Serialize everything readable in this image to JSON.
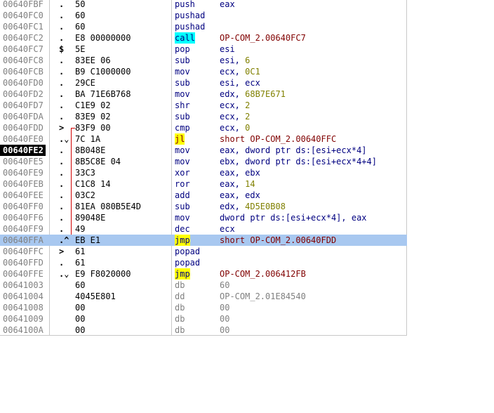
{
  "rows": [
    {
      "addr": "00640FBF",
      "mark": ".",
      "hex": "50",
      "mn": "push",
      "ops": [
        {
          "t": "eax",
          "c": "reg"
        }
      ]
    },
    {
      "addr": "00640FC0",
      "mark": ".",
      "hex": "60",
      "mn": "pushad",
      "ops": []
    },
    {
      "addr": "00640FC1",
      "mark": ".",
      "hex": "60",
      "mn": "pushad",
      "ops": []
    },
    {
      "addr": "00640FC2",
      "mark": ".",
      "hex": "E8 00000000",
      "mn": "call",
      "hl": "call",
      "ops": [
        {
          "t": "OP-COM_2.00640FC7",
          "c": "tgt"
        }
      ]
    },
    {
      "addr": "00640FC7",
      "mark": "$",
      "hex": "5E",
      "mn": "pop",
      "ops": [
        {
          "t": "esi",
          "c": "reg"
        }
      ]
    },
    {
      "addr": "00640FC8",
      "mark": ".",
      "hex": "83EE 06",
      "mn": "sub",
      "ops": [
        {
          "t": "esi, ",
          "c": "reg"
        },
        {
          "t": "6",
          "c": "num"
        }
      ]
    },
    {
      "addr": "00640FCB",
      "mark": ".",
      "hex": "B9 C1000000",
      "mn": "mov",
      "ops": [
        {
          "t": "ecx, ",
          "c": "reg"
        },
        {
          "t": "0C1",
          "c": "num"
        }
      ]
    },
    {
      "addr": "00640FD0",
      "mark": ".",
      "hex": "29CE",
      "mn": "sub",
      "ops": [
        {
          "t": "esi, ecx",
          "c": "reg"
        }
      ]
    },
    {
      "addr": "00640FD2",
      "mark": ".",
      "hex": "BA 71E6B768",
      "mn": "mov",
      "ops": [
        {
          "t": "edx, ",
          "c": "reg"
        },
        {
          "t": "68B7E671",
          "c": "num"
        }
      ]
    },
    {
      "addr": "00640FD7",
      "mark": ".",
      "hex": "C1E9 02",
      "mn": "shr",
      "ops": [
        {
          "t": "ecx, ",
          "c": "reg"
        },
        {
          "t": "2",
          "c": "num"
        }
      ]
    },
    {
      "addr": "00640FDA",
      "mark": ".",
      "hex": "83E9 02",
      "mn": "sub",
      "ops": [
        {
          "t": "ecx, ",
          "c": "reg"
        },
        {
          "t": "2",
          "c": "num"
        }
      ]
    },
    {
      "addr": "00640FDD",
      "mark": ">",
      "hex": "83F9 00",
      "mn": "cmp",
      "ops": [
        {
          "t": "ecx, ",
          "c": "reg"
        },
        {
          "t": "0",
          "c": "num"
        }
      ]
    },
    {
      "addr": "00640FE0",
      "mark": ".⌄",
      "hex": "7C 1A",
      "mn": "jl",
      "hl": "jl",
      "ops": [
        {
          "t": "short OP-COM_2.00640FFC",
          "c": "tgt"
        }
      ]
    },
    {
      "addr": "00640FE2",
      "mark": ".",
      "hex": "8B048E",
      "mn": "mov",
      "cur": true,
      "ops": [
        {
          "t": "eax, dword ptr ds:[esi+ecx*4]",
          "c": "reg"
        }
      ]
    },
    {
      "addr": "00640FE5",
      "mark": ".",
      "hex": "8B5C8E 04",
      "mn": "mov",
      "ops": [
        {
          "t": "ebx, dword ptr ds:[esi+ecx*4+4]",
          "c": "reg"
        }
      ]
    },
    {
      "addr": "00640FE9",
      "mark": ".",
      "hex": "33C3",
      "mn": "xor",
      "ops": [
        {
          "t": "eax, ebx",
          "c": "reg"
        }
      ]
    },
    {
      "addr": "00640FEB",
      "mark": ".",
      "hex": "C1C8 14",
      "mn": "ror",
      "ops": [
        {
          "t": "eax, ",
          "c": "reg"
        },
        {
          "t": "14",
          "c": "num"
        }
      ]
    },
    {
      "addr": "00640FEE",
      "mark": ".",
      "hex": "03C2",
      "mn": "add",
      "ops": [
        {
          "t": "eax, edx",
          "c": "reg"
        }
      ]
    },
    {
      "addr": "00640FF0",
      "mark": ".",
      "hex": "81EA 080B5E4D",
      "mn": "sub",
      "ops": [
        {
          "t": "edx, ",
          "c": "reg"
        },
        {
          "t": "4D5E0B08",
          "c": "num"
        }
      ]
    },
    {
      "addr": "00640FF6",
      "mark": ".",
      "hex": "89048E",
      "mn": "mov",
      "ops": [
        {
          "t": "dword ptr ds:[esi+ecx*4], eax",
          "c": "reg"
        }
      ]
    },
    {
      "addr": "00640FF9",
      "mark": ".",
      "hex": "49",
      "mn": "dec",
      "ops": [
        {
          "t": "ecx",
          "c": "reg"
        }
      ]
    },
    {
      "addr": "00640FFA",
      "mark": ".^",
      "hex": "EB E1",
      "mn": "jmp",
      "hl": "jmp",
      "sel": true,
      "ops": [
        {
          "t": "short OP-COM_2.00640FDD",
          "c": "tgt"
        }
      ]
    },
    {
      "addr": "00640FFC",
      "mark": ">",
      "hex": "61",
      "mn": "popad",
      "ops": []
    },
    {
      "addr": "00640FFD",
      "mark": ".",
      "hex": "61",
      "mn": "popad",
      "ops": []
    },
    {
      "addr": "00640FFE",
      "mark": ".⌄",
      "hex": "E9 F8020000",
      "mn": "jmp",
      "hl": "jmp",
      "ops": [
        {
          "t": "OP-COM_2.006412FB",
          "c": "tgt"
        }
      ]
    },
    {
      "addr": "00641003",
      "mark": "",
      "hex": "60",
      "mn": "db",
      "db": true,
      "ops": [
        {
          "t": "60",
          "c": "gray"
        }
      ]
    },
    {
      "addr": "00641004",
      "mark": "",
      "hex": "4045E801",
      "mn": "dd",
      "db": true,
      "ops": [
        {
          "t": "OP-COM_2.01E84540",
          "c": "gray"
        }
      ]
    },
    {
      "addr": "00641008",
      "mark": "",
      "hex": "00",
      "mn": "db",
      "db": true,
      "ops": [
        {
          "t": "00",
          "c": "gray"
        }
      ]
    },
    {
      "addr": "00641009",
      "mark": "",
      "hex": "00",
      "mn": "db",
      "db": true,
      "ops": [
        {
          "t": "00",
          "c": "gray"
        }
      ]
    },
    {
      "addr": "0064100A",
      "mark": "",
      "hex": "00",
      "mn": "db",
      "db": true,
      "ops": [
        {
          "t": "00",
          "c": "gray"
        }
      ]
    }
  ],
  "colors": {
    "selection": "#a8c8f0",
    "call_highlight": "#00ffff",
    "jump_highlight": "#ffff00",
    "jump_arrow": "#d00000"
  }
}
